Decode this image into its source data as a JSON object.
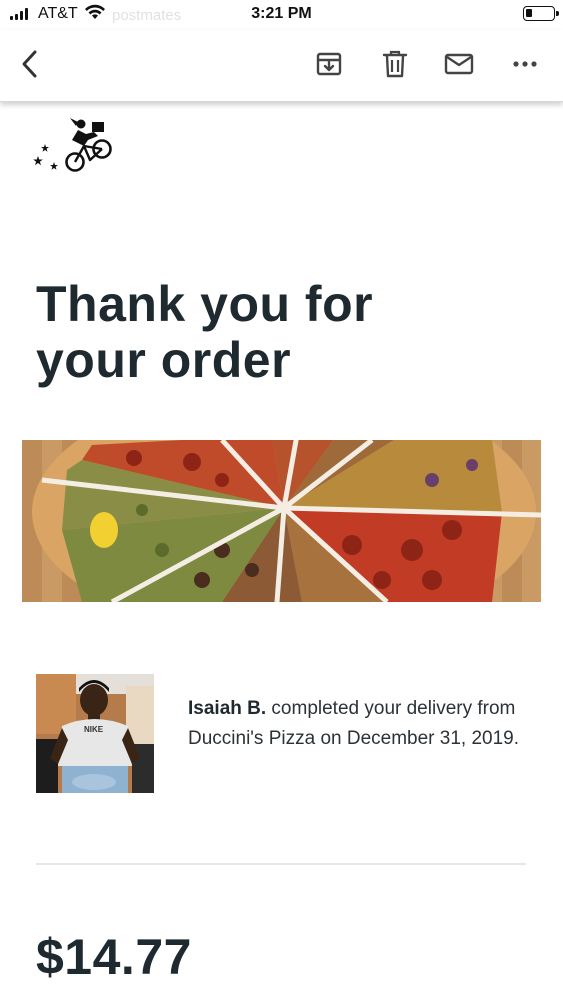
{
  "status_bar": {
    "carrier": "AT&T",
    "time": "3:21 PM",
    "battery_level": 0.25
  },
  "ghost_header": {
    "sender": "postmates"
  },
  "toolbar": {
    "back_icon": "chevron-left-icon",
    "archive_icon": "archive-icon",
    "delete_icon": "trash-icon",
    "mark_icon": "mail-icon",
    "more_icon": "more-icon"
  },
  "email": {
    "headline_line1": "Thank you for",
    "headline_line2": "your order",
    "courier_name": "Isaiah B.",
    "delivery_message": " completed your delivery from Duccini's Pizza on December 31, 2019.",
    "total": "$14.77",
    "shirt_text": "NIKE"
  },
  "colors": {
    "text": "#1f2a30",
    "divider": "#e6e6e6"
  }
}
